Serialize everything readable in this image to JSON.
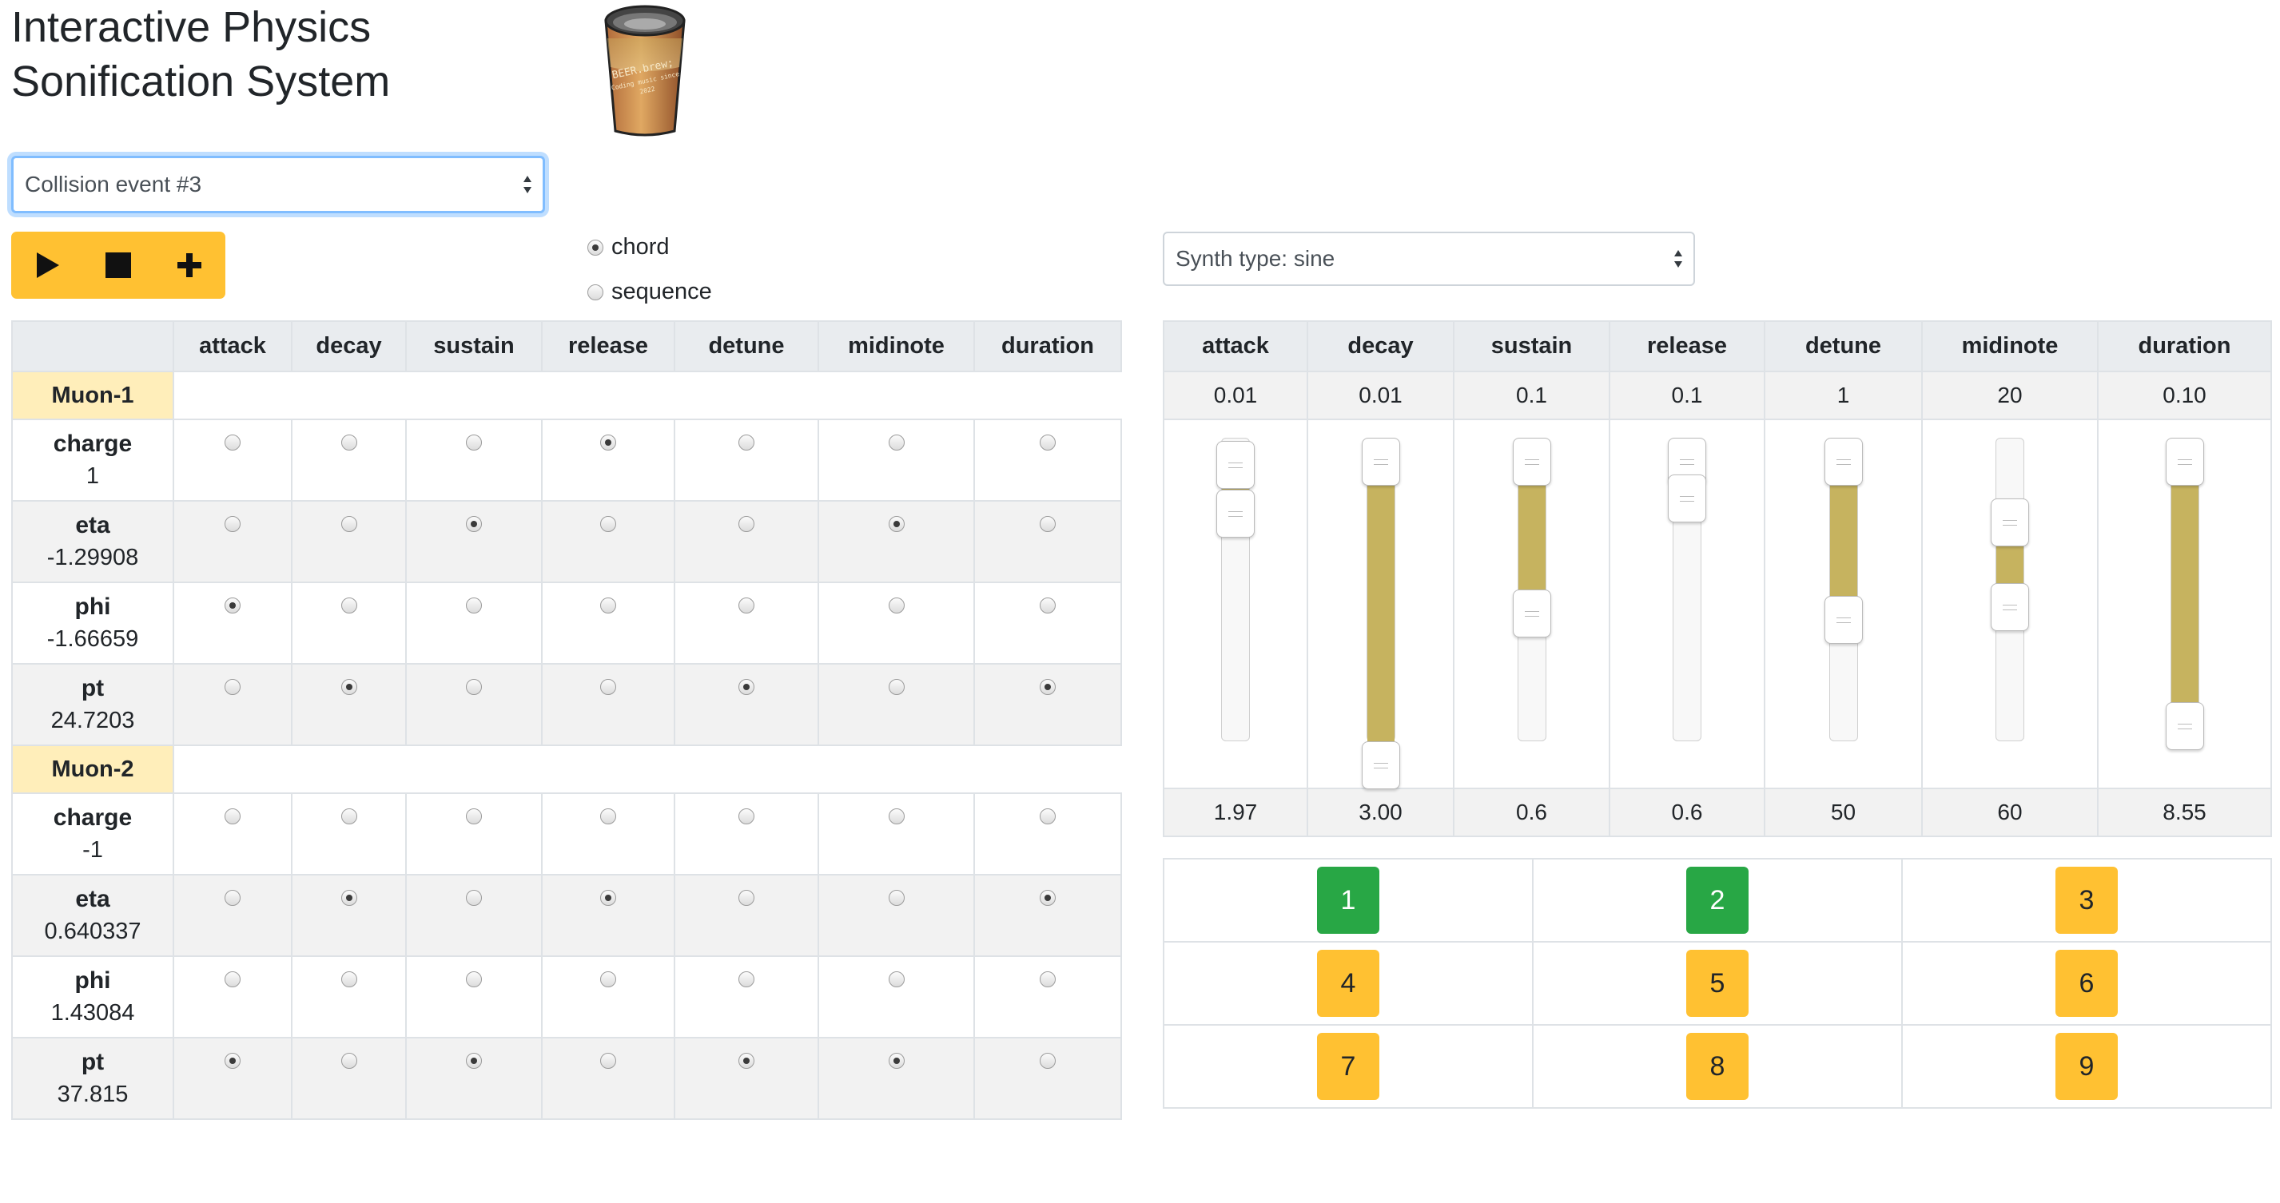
{
  "header": {
    "title_line1": "Interactive Physics",
    "title_line2": "Sonification System",
    "logo": {
      "text_line1": "BEER.brew;",
      "text_line2": "Coding music since",
      "text_line3": "2022"
    }
  },
  "event_select": {
    "value": "Collision event #3"
  },
  "synth_select": {
    "value": "Synth type: sine"
  },
  "transport": {
    "play_icon": "play-icon",
    "stop_icon": "stop-icon",
    "add_icon": "plus-icon"
  },
  "mode": {
    "options": [
      "chord",
      "sequence"
    ],
    "selected": "chord"
  },
  "mapping": {
    "corner": "",
    "columns": [
      "attack",
      "decay",
      "sustain",
      "release",
      "detune",
      "midinote",
      "duration"
    ],
    "particles": [
      {
        "name": "Muon-1",
        "properties": [
          {
            "name": "charge",
            "value": "1",
            "selected": [
              false,
              false,
              false,
              true,
              false,
              false,
              false
            ]
          },
          {
            "name": "eta",
            "value": "-1.29908",
            "selected": [
              false,
              false,
              true,
              false,
              false,
              true,
              false
            ]
          },
          {
            "name": "phi",
            "value": "-1.66659",
            "selected": [
              true,
              false,
              false,
              false,
              false,
              false,
              false
            ]
          },
          {
            "name": "pt",
            "value": "24.7203",
            "selected": [
              false,
              true,
              false,
              false,
              true,
              false,
              true
            ]
          }
        ]
      },
      {
        "name": "Muon-2",
        "properties": [
          {
            "name": "charge",
            "value": "-1",
            "selected": [
              false,
              false,
              false,
              false,
              false,
              false,
              false
            ]
          },
          {
            "name": "eta",
            "value": "0.640337",
            "selected": [
              false,
              true,
              false,
              true,
              false,
              false,
              true
            ]
          },
          {
            "name": "phi",
            "value": "1.43084",
            "selected": [
              false,
              false,
              false,
              false,
              false,
              false,
              false
            ]
          },
          {
            "name": "pt",
            "value": "37.815",
            "selected": [
              true,
              false,
              true,
              false,
              true,
              true,
              false
            ]
          }
        ]
      }
    ]
  },
  "synth": {
    "columns": [
      "attack",
      "decay",
      "sustain",
      "release",
      "detune",
      "midinote",
      "duration"
    ],
    "min": [
      "0.01",
      "0.01",
      "0.1",
      "0.1",
      "1",
      "20",
      "0.10"
    ],
    "max": [
      "1.97",
      "3.00",
      "0.6",
      "0.6",
      "50",
      "60",
      "8.55"
    ],
    "ranges": [
      {
        "low": 0.01,
        "high": 0.17
      },
      {
        "low": 0.0,
        "high": 1.0
      },
      {
        "low": 0.0,
        "high": 0.5
      },
      {
        "low": 0.0,
        "high": 0.12
      },
      {
        "low": 0.0,
        "high": 0.52
      },
      {
        "low": 0.2,
        "high": 0.48
      },
      {
        "low": 0.0,
        "high": 0.87
      }
    ]
  },
  "presets": {
    "labels": [
      "1",
      "2",
      "3",
      "4",
      "5",
      "6",
      "7",
      "8",
      "9"
    ],
    "active": [
      true,
      true,
      false,
      false,
      false,
      false,
      false,
      false,
      false
    ]
  }
}
